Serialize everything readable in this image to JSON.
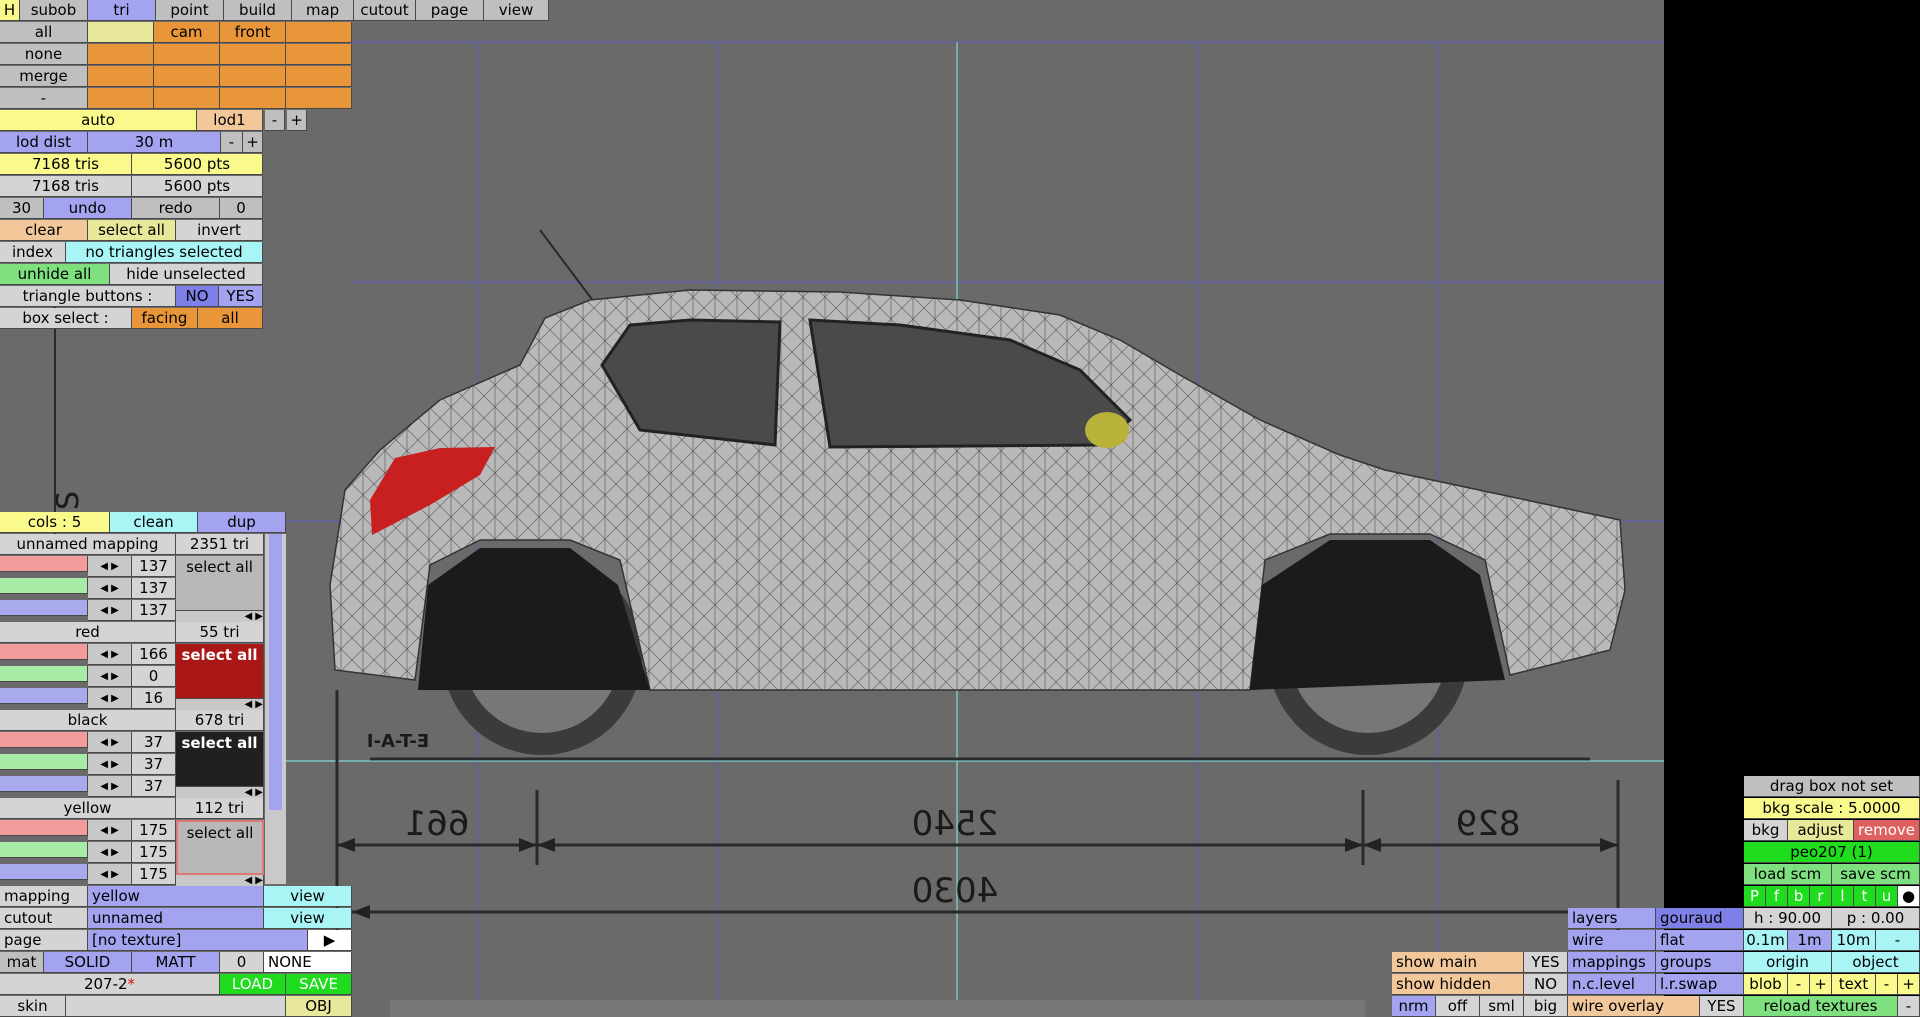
{
  "tabs": {
    "h": "H",
    "items": [
      "subob",
      "tri",
      "point",
      "build",
      "map",
      "cutout",
      "page",
      "view"
    ]
  },
  "sel_rows": [
    {
      "label": "all",
      "c2": "cam",
      "c3": "front"
    },
    {
      "label": "none"
    },
    {
      "label": "merge"
    },
    {
      "label": "-"
    }
  ],
  "lod": {
    "auto": "auto",
    "lod1": "lod1",
    "minus": "-",
    "plus": "+",
    "dist_label": "lod dist",
    "dist_value": "30 m"
  },
  "stats": {
    "tris1": "7168 tris",
    "pts1": "5600 pts",
    "tris2": "7168 tris",
    "pts2": "5600 pts"
  },
  "undo": {
    "count": "30",
    "undo": "undo",
    "redo": "redo",
    "redo_count": "0"
  },
  "actions": {
    "clear": "clear",
    "select_all": "select all",
    "invert": "invert"
  },
  "index": {
    "label": "index",
    "value": "no triangles selected"
  },
  "hide": {
    "unhide_all": "unhide all",
    "hide_unselected": "hide unselected"
  },
  "tri_buttons": {
    "label": "triangle buttons :",
    "no": "NO",
    "yes": "YES"
  },
  "box_select": {
    "label": "box select :",
    "facing": "facing",
    "all": "all"
  },
  "cols": {
    "label": "cols : 5",
    "clean": "clean",
    "dup": "dup"
  },
  "mappings": [
    {
      "name": "unnamed mapping",
      "tri": "2351 tri",
      "r": "137",
      "g": "137",
      "b": "137",
      "select": "select all"
    },
    {
      "name": "red",
      "tri": "55 tri",
      "r": "166",
      "g": "0",
      "b": "16",
      "select": "select all"
    },
    {
      "name": "black",
      "tri": "678 tri",
      "r": "37",
      "g": "37",
      "b": "37",
      "select": "select all"
    },
    {
      "name": "yellow",
      "tri": "112 tri",
      "r": "175",
      "g": "175",
      "b": "175",
      "select": "select all"
    }
  ],
  "props": {
    "mapping_label": "mapping",
    "mapping_value": "yellow",
    "mapping_view": "view",
    "cutout_label": "cutout",
    "cutout_value": "unnamed",
    "cutout_view": "view",
    "page_label": "page",
    "page_value": "[no texture]",
    "page_arrow": "▶",
    "mat_label": "mat",
    "mat_solid": "SOLID",
    "mat_matt": "MATT",
    "mat_num": "0",
    "mat_none": "NONE",
    "file_name": "207-2",
    "file_mark": "*",
    "load": "LOAD",
    "save": "SAVE",
    "skin_label": "skin",
    "obj": "OBJ"
  },
  "render": {
    "show_main": "show main",
    "show_main_v": "YES",
    "show_hidden": "show hidden",
    "show_hidden_v": "NO",
    "nrm": "nrm",
    "off": "off",
    "sml": "sml",
    "big": "big",
    "layers": "layers",
    "gouraud": "gouraud",
    "wire": "wire",
    "flat": "flat",
    "mappings": "mappings",
    "groups": "groups",
    "nclevel": "n.c.level",
    "lrswap": "l.r.swap",
    "wire_overlay": "wire overlay",
    "wire_overlay_v": "YES"
  },
  "right": {
    "drag_box": "drag box not set",
    "bkg_scale": "bkg scale : 5.0000",
    "bkg": "bkg",
    "adjust": "adjust",
    "remove": "remove",
    "model": "peo207 (1)",
    "load_scm": "load scm",
    "save_scm": "save scm",
    "views": [
      "P",
      "f",
      "b",
      "r",
      "l",
      "t",
      "u",
      "●"
    ],
    "h": "h : 90.00",
    "p": "p : 0.00",
    "s1": "0.1m",
    "s2": "1m",
    "s3": "10m",
    "sm": "-",
    "origin": "origin",
    "object": "object",
    "blob": "blob",
    "text": "text",
    "pm": "-",
    "pp": "+",
    "reload": "reload textures",
    "rl": "-"
  },
  "blueprint": {
    "d1": "661",
    "d2": "2540",
    "d3": "829",
    "total": "4030",
    "label": "E-T-A-I",
    "s": "S"
  },
  "colors": {
    "viewport": "#6a6a6a",
    "grid": "#5a5ac8",
    "guide": "#7fd8d8"
  }
}
